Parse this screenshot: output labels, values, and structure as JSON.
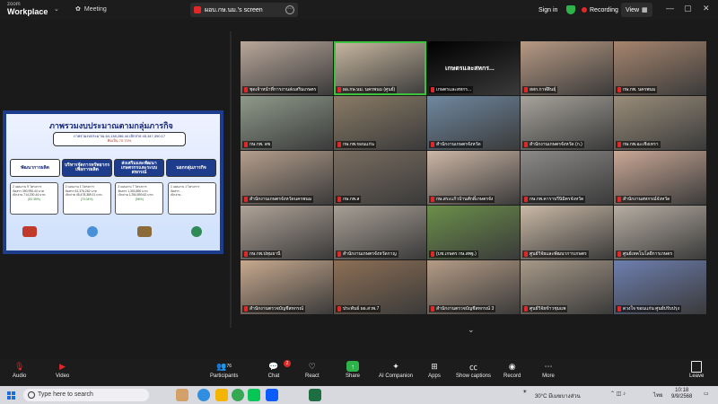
{
  "app": {
    "brand_top": "zoom",
    "brand_bottom": "Workplace",
    "meeting_label": "Meeting"
  },
  "share_tab": {
    "label": "ผอบ.กษ.นม.'s screen"
  },
  "topbar": {
    "signin": "Sign in",
    "recording": "Recording",
    "view": "View"
  },
  "slide": {
    "title": "ภาพรวมงบประมาณตามกลุ่มภารกิจ",
    "budget_line1": "ภาพรวมงบประมาณ 64,138,286.44 เบิกจ่าย 45,347,390.17",
    "budget_line2": "คิดเป็น 70.70%",
    "categories": [
      "พัฒนาการผลิต",
      "บริหารจัดการทรัพยากร เพื่อการผลิต",
      "ส่งเสริมและพัฒนา เกษตรกรและระบบสหกรณ์",
      "นอกกลุ่มภารกิจ"
    ],
    "details": [
      {
        "l1": "2 แผนงาน 9 โครงการ",
        "l2": "จัดสรร 390,990.44 บาท",
        "l3": "เบิกจ่าย 714,230.44 บาท",
        "l4": "(83.35%)"
      },
      {
        "l1": "2 แผนงาน 1 โครงการ",
        "l2": "จัดสรร 61,376,262 บาท",
        "l3": "เบิกจ่าย 45,478,389.11 บาท",
        "l4": "(70.04%)"
      },
      {
        "l1": "2 แผนงาน 7 โครงการ",
        "l2": "จัดสรร 1,300,890 บาท",
        "l3": "เบิกจ่าย 1,254,890.62 บาท",
        "l4": "(96%)"
      },
      {
        "l1": "1 แผนงาน 1 โครงการ",
        "l2": "จัดสรร -",
        "l3": "เบิกจ่าย -",
        "l4": ""
      }
    ]
  },
  "participants": [
    {
      "label": "ชุดเจ้าหน้าที่การงานส่งเสริมเกษตร",
      "bg": "#b9a79a"
    },
    {
      "label": "ผอ.กษ.นม. นครพนม (ศูนย์)",
      "bg": "#c9b8a0",
      "active": true
    },
    {
      "label": "เกษตรและสหกร...",
      "bg": "#000000",
      "big": "เกษตรและสหกร..."
    },
    {
      "label": "สสก.กาฬสินธุ์",
      "bg": "#b89a84"
    },
    {
      "label": "กษ.กพ. นครพนม",
      "bg": "#a6856e"
    },
    {
      "label": "กษ.กพ. ดข",
      "bg": "#8f9a8a"
    },
    {
      "label": "กษ.กพ.ขอนแก่น",
      "bg": "#8a7b66"
    },
    {
      "label": "สำนักงานเกษตรจังหวัด",
      "bg": "#6f88a0"
    },
    {
      "label": "สำนักงานเกษตรจังหวัด (ก.)",
      "bg": "#a7a39b"
    },
    {
      "label": "กษ.กพ.ฉะเชิงเทรา",
      "bg": "#9a8d7a"
    },
    {
      "label": "สำนักงานเกษตรจังหวัดนครพนม",
      "bg": "#b49e8c"
    },
    {
      "label": "กษ.กพ.ส",
      "bg": "#7a6d60"
    },
    {
      "label": "กษ.สระแก้วบ้านศักดิ์เกษตรจัง",
      "bg": "#cdb7a6"
    },
    {
      "label": "กษ.กพ.คาราบรีนิมิตรจังหวัด",
      "bg": "#8c8a88"
    },
    {
      "label": "สำนักงานสหกรณ์จังหวัด",
      "bg": "#caa896"
    },
    {
      "label": "กษ.กพ.ปทุมธานี",
      "bg": "#b0a398"
    },
    {
      "label": "สำนักงานเกษตรจังหวัดกาญ",
      "bg": "#a89f95"
    },
    {
      "label": "(บช.เกษตร กษ.สพฐ.)",
      "bg": "#6b8f4a"
    },
    {
      "label": "ศูนย์วิจัยและพัฒนาการเกษตร",
      "bg": "#cab9a6"
    },
    {
      "label": "ศูนย์เทคโนโลยีการเกษตร",
      "bg": "#b7aea3"
    },
    {
      "label": "สำนักงานตรวจบัญชีสหกรณ์",
      "bg": "#c7a98e"
    },
    {
      "label": "ประพันธ์ ผอ.สวพ.7",
      "bg": "#8d6f55"
    },
    {
      "label": "สำนักงานตรวจบัญชีสหกรณ์ 3",
      "bg": "#b59c86"
    },
    {
      "label": "ศูนย์วิจัยข้าวชุมแพ",
      "bg": "#a79988"
    },
    {
      "label": "ดวงใจ ขอนแก่น ศูนย์ปรับปรุง",
      "bg": "#6e7fb0"
    }
  ],
  "toolbar": {
    "audio": "Audio",
    "video": "Video",
    "participants": "Participants",
    "participants_count": "76",
    "chat": "Chat",
    "chat_badge": "2",
    "react": "React",
    "share": "Share",
    "ai_companion": "AI Companion",
    "apps": "Apps",
    "show_captions": "Show captions",
    "record": "Record",
    "more": "More",
    "leave": "Leave"
  },
  "taskbar": {
    "search_placeholder": "Type here to search",
    "weather": "30°C มีเมฆบางส่วน",
    "lang": "ไทย",
    "time": "10:18",
    "date": "9/9/2568"
  },
  "colors": {
    "accent_green": "#2db34a",
    "record_red": "#e02828",
    "slide_navy": "#1e3c8c"
  }
}
